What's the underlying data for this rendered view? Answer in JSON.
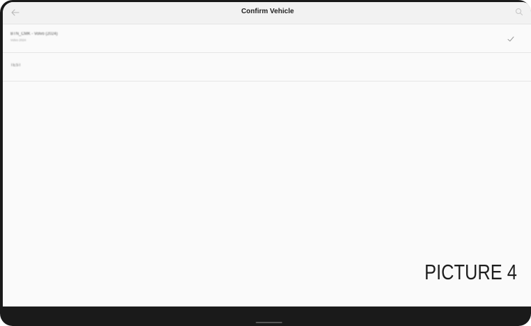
{
  "header": {
    "title": "Confirm Vehicle",
    "back_icon": "arrow-left-icon",
    "search_icon": "search-icon"
  },
  "list": {
    "items": [
      {
        "primary": "BTN_CMK - Volvo (2024)",
        "secondary": "Volvo 2024",
        "selected": true,
        "check_icon": "checkmark-icon"
      },
      {
        "primary": "TEST",
        "secondary": "",
        "selected": false
      }
    ]
  },
  "watermark": {
    "text": "PICTURE 4"
  },
  "colors": {
    "appbar_bg": "#f2f2f2",
    "screen_bg": "#fafafa",
    "bezel": "#1a1a1a",
    "divider": "#e6e6e6"
  }
}
